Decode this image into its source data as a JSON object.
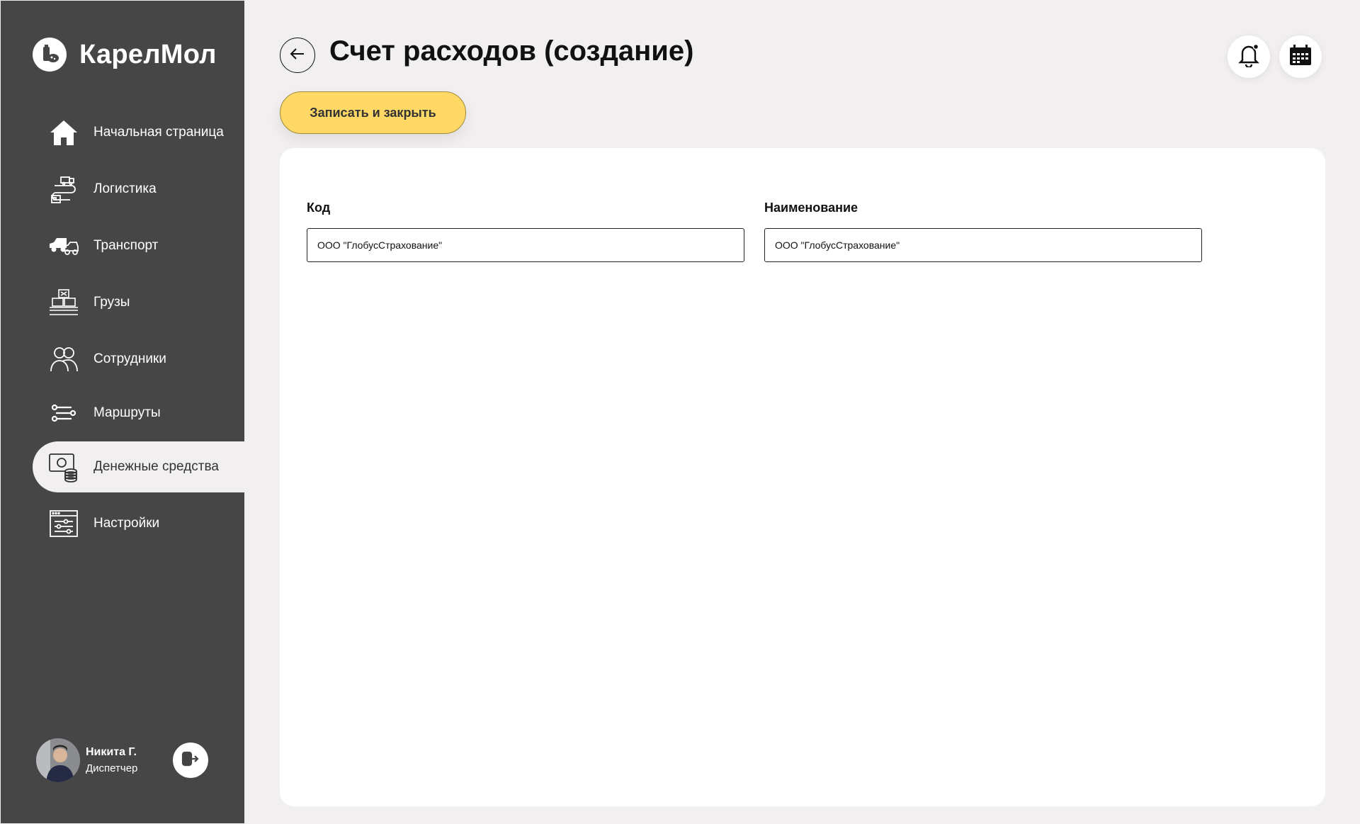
{
  "brand": {
    "name": "КарелМол"
  },
  "sidebar": {
    "items": [
      {
        "label": "Начальная страница",
        "icon": "home-icon"
      },
      {
        "label": "Логистика",
        "icon": "logistics-icon"
      },
      {
        "label": "Транспорт",
        "icon": "transport-icon"
      },
      {
        "label": "Грузы",
        "icon": "cargo-icon"
      },
      {
        "label": "Сотрудники",
        "icon": "employees-icon"
      },
      {
        "label": "Маршруты",
        "icon": "routes-icon"
      },
      {
        "label": "Денежные средства",
        "icon": "money-icon",
        "active": true
      },
      {
        "label": "Настройки",
        "icon": "settings-icon"
      }
    ]
  },
  "user": {
    "name": "Никита Г.",
    "role": "Диспетчер"
  },
  "header": {
    "title": "Счет расходов (создание)",
    "save_label": "Записать и закрыть"
  },
  "form": {
    "code": {
      "label": "Код",
      "value": "ООО \"ГлобусСтрахование\""
    },
    "name": {
      "label": "Наименование",
      "value": "ООО \"ГлобусСтрахование\""
    }
  },
  "colors": {
    "sidebar": "#464646",
    "background": "#f2eff0",
    "accent": "#ffd866"
  }
}
